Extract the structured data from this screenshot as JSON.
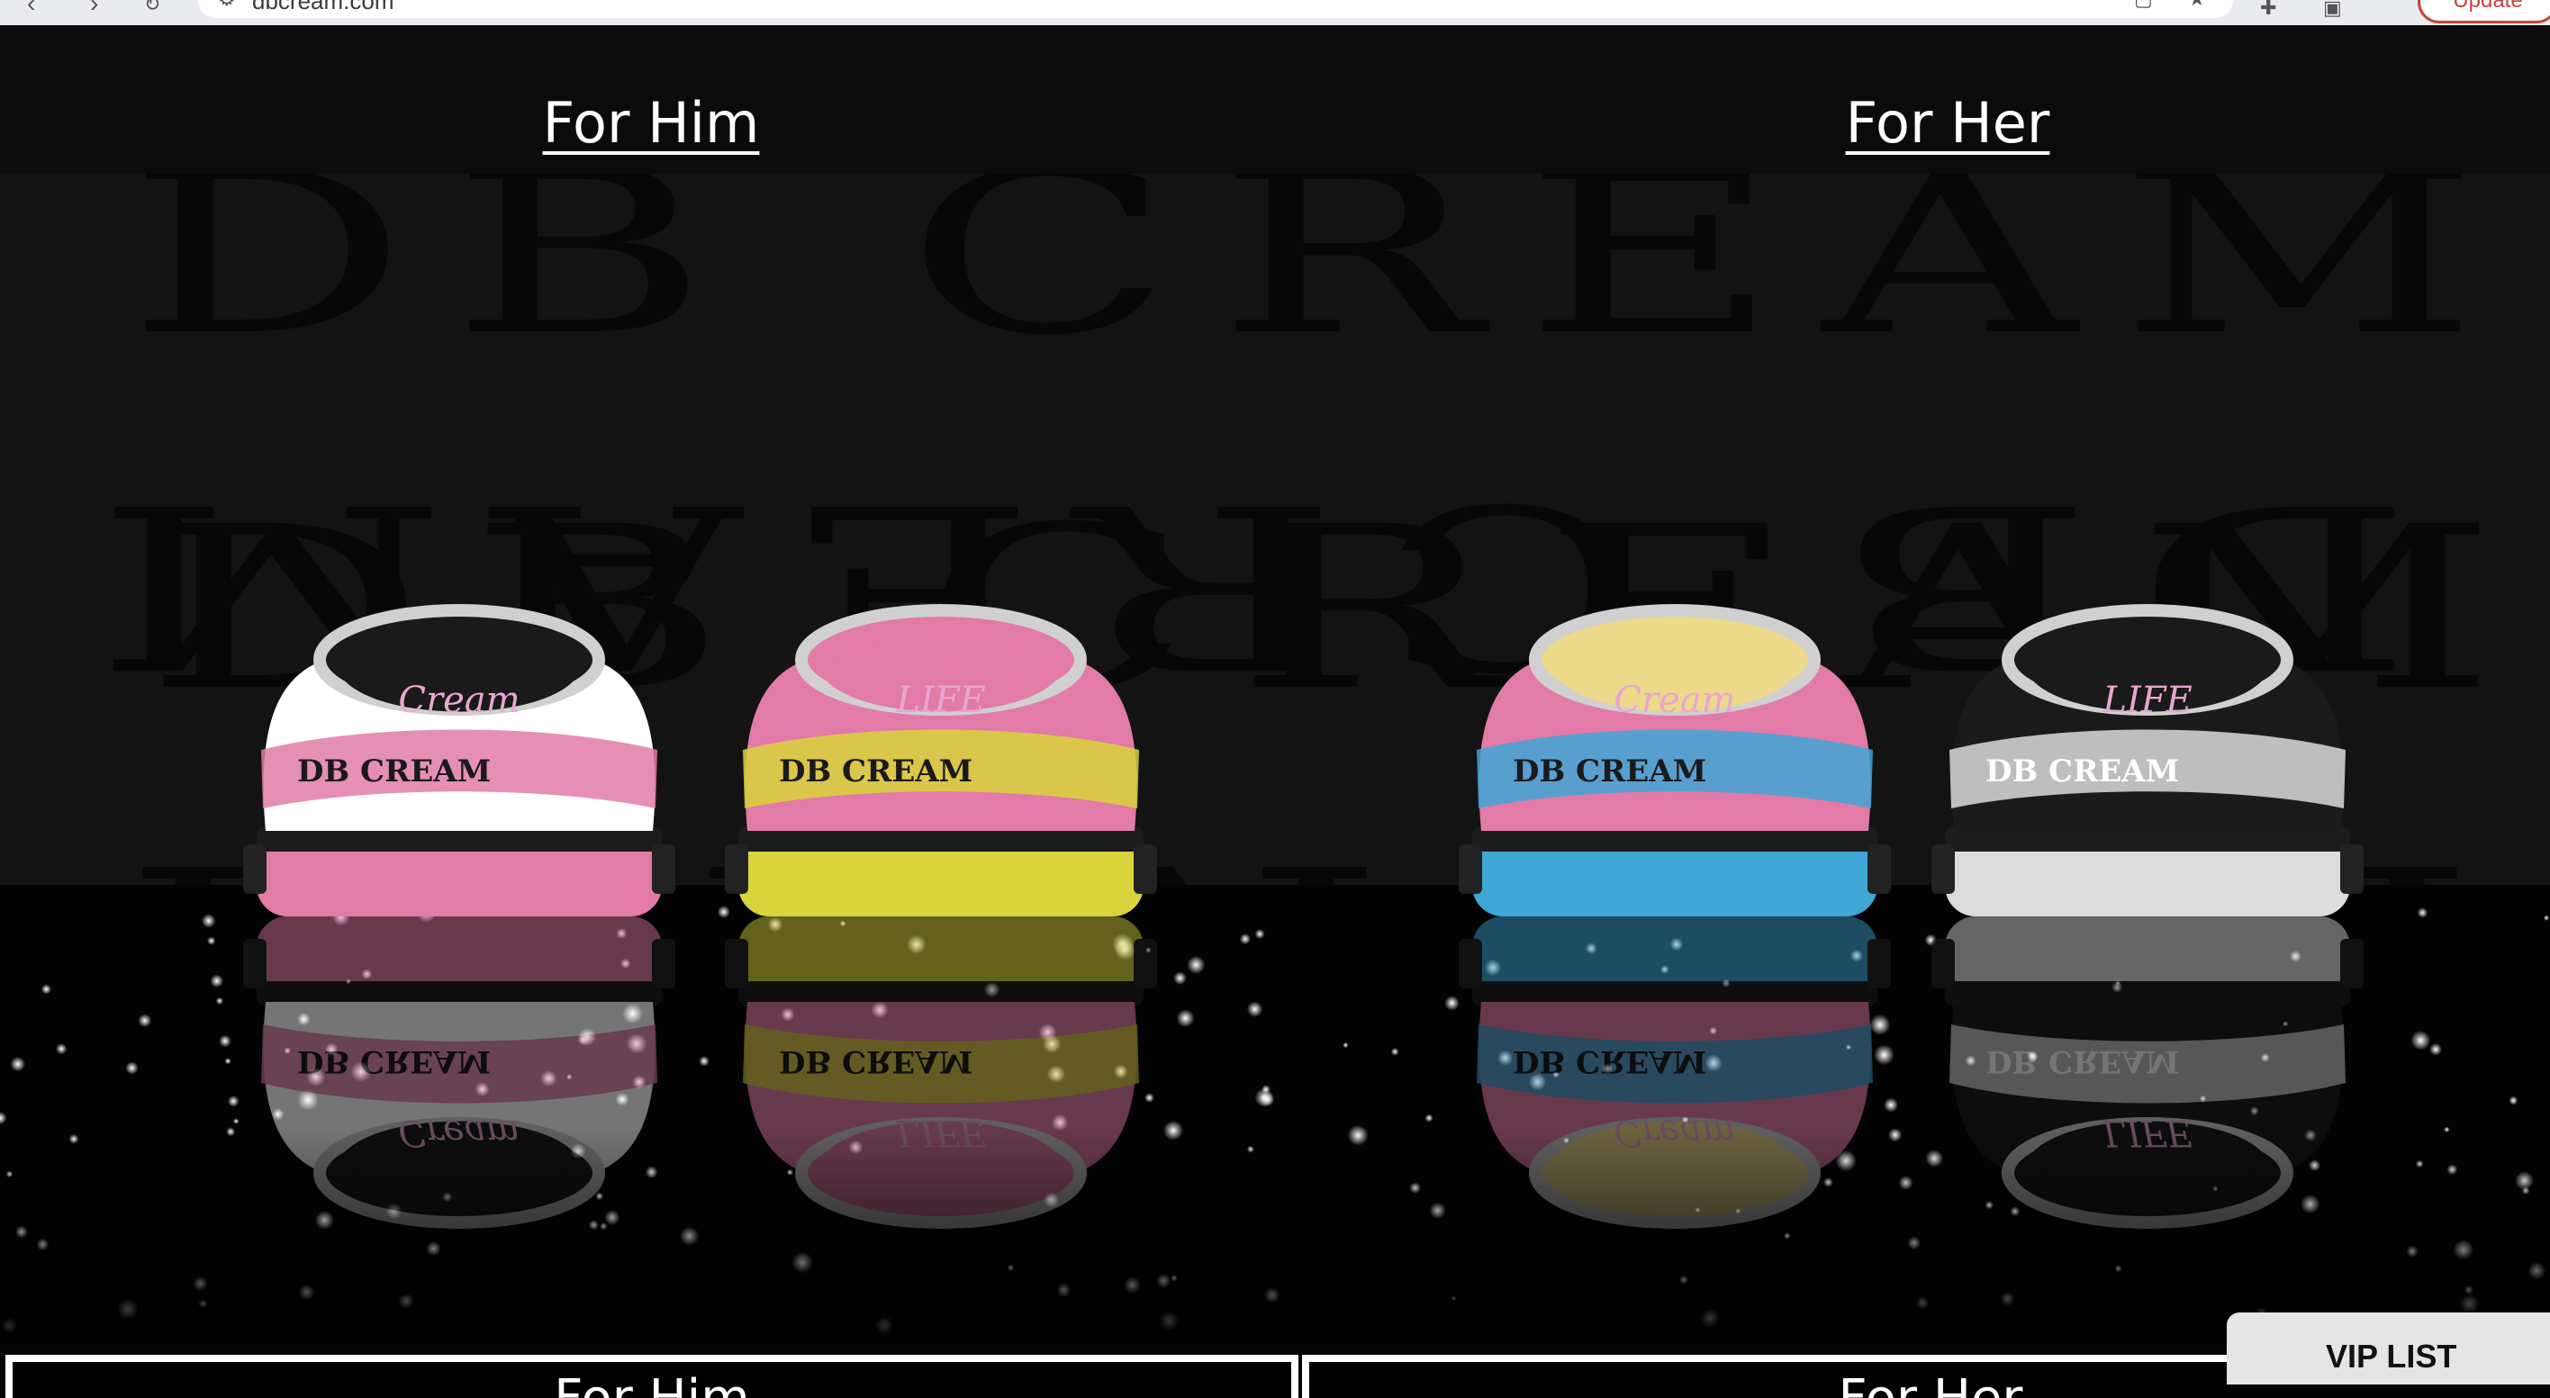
{
  "browser": {
    "url": "dbcream.com",
    "update_label": "Update"
  },
  "nav": {
    "for_him": "For Him",
    "for_her": "For Her"
  },
  "hero": {
    "background_text": "DB CREAM",
    "shoes": [
      {
        "tongue_text": "Cream",
        "main_color": "#e27ba8",
        "accent_color": "#ffffff",
        "tongue_color": "#1a1a1a"
      },
      {
        "tongue_text": "LIFE",
        "main_color": "#d9d33c",
        "accent_color": "#e27ba8",
        "tongue_color": "#e27ba8"
      },
      {
        "tongue_text": "Cream",
        "main_color": "#3fa6d6",
        "accent_color": "#e27ba8",
        "tongue_color": "#ecd98a"
      },
      {
        "tongue_text": "LIFE",
        "main_color": "#dcdcdc",
        "accent_color": "#1a1a1a",
        "tongue_color": "#1a1a1a"
      }
    ],
    "pattern_text": "DB CREAM"
  },
  "tiles": {
    "left_label": "For Him",
    "right_label": "For Her"
  },
  "vip": {
    "label": "VIP LIST"
  }
}
